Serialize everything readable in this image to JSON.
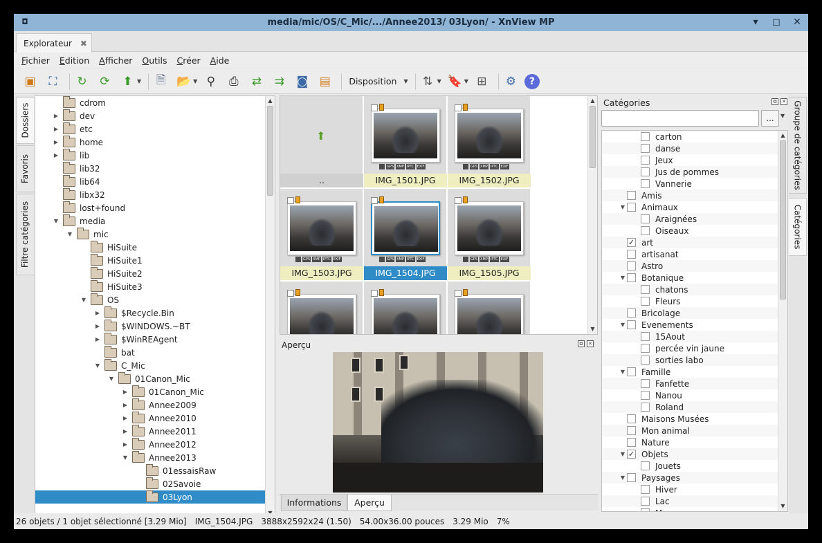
{
  "window": {
    "title": "media/mic/OS/C_Mic/.../Annee2013/ 03Lyon/ - XnView MP",
    "app_icon": "app-icon",
    "controls": [
      "minimize-icon",
      "maximize-icon",
      "close-icon"
    ]
  },
  "tab": {
    "label": "Explorateur"
  },
  "menu": [
    "Fichier",
    "Edition",
    "Afficher",
    "Outils",
    "Créer",
    "Aide"
  ],
  "toolbar": {
    "disposition_label": "Disposition"
  },
  "side_tabs": [
    "Dossiers",
    "Favoris",
    "Filtre catégories"
  ],
  "folder_tree": [
    {
      "label": "cdrom",
      "level": 1,
      "arrow": ""
    },
    {
      "label": "dev",
      "level": 1,
      "arrow": "▶"
    },
    {
      "label": "etc",
      "level": 1,
      "arrow": "▶"
    },
    {
      "label": "home",
      "level": 1,
      "arrow": "▶"
    },
    {
      "label": "lib",
      "level": 1,
      "arrow": "▶"
    },
    {
      "label": "lib32",
      "level": 1,
      "arrow": ""
    },
    {
      "label": "lib64",
      "level": 1,
      "arrow": ""
    },
    {
      "label": "libx32",
      "level": 1,
      "arrow": ""
    },
    {
      "label": "lost+found",
      "level": 1,
      "arrow": ""
    },
    {
      "label": "media",
      "level": 1,
      "arrow": "▼"
    },
    {
      "label": "mic",
      "level": 2,
      "arrow": "▼"
    },
    {
      "label": "HiSuite",
      "level": 3,
      "arrow": ""
    },
    {
      "label": "HiSuite1",
      "level": 3,
      "arrow": ""
    },
    {
      "label": "HiSuite2",
      "level": 3,
      "arrow": ""
    },
    {
      "label": "HiSuite3",
      "level": 3,
      "arrow": ""
    },
    {
      "label": "OS",
      "level": 3,
      "arrow": "▼"
    },
    {
      "label": "$Recycle.Bin",
      "level": 4,
      "arrow": "▶"
    },
    {
      "label": "$WINDOWS.~BT",
      "level": 4,
      "arrow": "▶"
    },
    {
      "label": "$WinREAgent",
      "level": 4,
      "arrow": "▶"
    },
    {
      "label": "bat",
      "level": 4,
      "arrow": ""
    },
    {
      "label": "C_Mic",
      "level": 4,
      "arrow": "▼"
    },
    {
      "label": "01Canon_Mic",
      "level": 5,
      "arrow": "▼"
    },
    {
      "label": "01Canon_Mic",
      "level": 6,
      "arrow": "▶"
    },
    {
      "label": "Annee2009",
      "level": 6,
      "arrow": "▶"
    },
    {
      "label": "Annee2010",
      "level": 6,
      "arrow": "▶"
    },
    {
      "label": "Annee2011",
      "level": 6,
      "arrow": "▶"
    },
    {
      "label": "Annee2012",
      "level": 6,
      "arrow": "▶"
    },
    {
      "label": "Annee2013",
      "level": 6,
      "arrow": "▼"
    },
    {
      "label": "01essaisRaw",
      "level": 7,
      "arrow": ""
    },
    {
      "label": "02Savoie",
      "level": 7,
      "arrow": ""
    },
    {
      "label": "03Lyon",
      "level": 7,
      "arrow": "",
      "selected": true
    }
  ],
  "thumbnails": [
    {
      "label": "..",
      "type": "parent"
    },
    {
      "label": "IMG_1501.JPG"
    },
    {
      "label": "IMG_1502.JPG"
    },
    {
      "label": "IMG_1503.JPG"
    },
    {
      "label": "IMG_1504.JPG",
      "selected": true
    },
    {
      "label": "IMG_1505.JPG"
    },
    {
      "label": ""
    },
    {
      "label": ""
    },
    {
      "label": ""
    }
  ],
  "meta_badges": [
    "GPS",
    "XMP",
    "IPTC",
    "EXIF"
  ],
  "preview": {
    "title": "Aperçu",
    "tabs": [
      "Informations",
      "Aperçu"
    ]
  },
  "categories": {
    "title": "Catégories",
    "more_label": "...",
    "items": [
      {
        "label": "carton",
        "level": 2,
        "checked": false,
        "arrow": ""
      },
      {
        "label": "danse",
        "level": 2,
        "checked": false,
        "arrow": ""
      },
      {
        "label": "Jeux",
        "level": 2,
        "checked": false,
        "arrow": ""
      },
      {
        "label": "Jus de pommes",
        "level": 2,
        "checked": false,
        "arrow": ""
      },
      {
        "label": "Vannerie",
        "level": 2,
        "checked": false,
        "arrow": ""
      },
      {
        "label": "Amis",
        "level": 1,
        "checked": false,
        "arrow": ""
      },
      {
        "label": "Animaux",
        "level": 1,
        "checked": false,
        "arrow": "▼"
      },
      {
        "label": "Araignées",
        "level": 2,
        "checked": false,
        "arrow": ""
      },
      {
        "label": "Oiseaux",
        "level": 2,
        "checked": false,
        "arrow": ""
      },
      {
        "label": "art",
        "level": 1,
        "checked": true,
        "arrow": ""
      },
      {
        "label": "artisanat",
        "level": 1,
        "checked": false,
        "arrow": ""
      },
      {
        "label": "Astro",
        "level": 1,
        "checked": false,
        "arrow": ""
      },
      {
        "label": "Botanique",
        "level": 1,
        "checked": false,
        "arrow": "▼"
      },
      {
        "label": " chatons",
        "level": 2,
        "checked": false,
        "arrow": ""
      },
      {
        "label": "Fleurs",
        "level": 2,
        "checked": false,
        "arrow": ""
      },
      {
        "label": "Bricolage",
        "level": 1,
        "checked": false,
        "arrow": ""
      },
      {
        "label": "Evenements",
        "level": 1,
        "checked": false,
        "arrow": "▼"
      },
      {
        "label": "15Aout",
        "level": 2,
        "checked": false,
        "arrow": ""
      },
      {
        "label": "percée vin jaune",
        "level": 2,
        "checked": false,
        "arrow": ""
      },
      {
        "label": "sorties labo",
        "level": 2,
        "checked": false,
        "arrow": ""
      },
      {
        "label": "Famille",
        "level": 1,
        "checked": false,
        "arrow": "▼"
      },
      {
        "label": "Fanfette",
        "level": 2,
        "checked": false,
        "arrow": ""
      },
      {
        "label": "Nanou",
        "level": 2,
        "checked": false,
        "arrow": ""
      },
      {
        "label": "Roland",
        "level": 2,
        "checked": false,
        "arrow": ""
      },
      {
        "label": "Maisons Musées",
        "level": 1,
        "checked": false,
        "arrow": ""
      },
      {
        "label": "Mon animal",
        "level": 1,
        "checked": false,
        "arrow": ""
      },
      {
        "label": "Nature",
        "level": 1,
        "checked": false,
        "arrow": ""
      },
      {
        "label": "Objets",
        "level": 1,
        "checked": true,
        "arrow": "▼"
      },
      {
        "label": "Jouets",
        "level": 2,
        "checked": false,
        "arrow": ""
      },
      {
        "label": "Paysages",
        "level": 1,
        "checked": false,
        "arrow": "▼"
      },
      {
        "label": "Hiver",
        "level": 2,
        "checked": false,
        "arrow": ""
      },
      {
        "label": "Lac",
        "level": 2,
        "checked": false,
        "arrow": ""
      },
      {
        "label": "M...",
        "level": 2,
        "checked": false,
        "arrow": ""
      }
    ]
  },
  "right_tabs": [
    "Groupe de catégories",
    "Catégories"
  ],
  "status": {
    "objects": "26 objets / 1 objet sélectionné [3.29 Mio]",
    "filename": "IMG_1504.JPG",
    "dimensions": "3888x2592x24 (1.50)",
    "print_size": "54.00x36.00 pouces",
    "filesize": "3.29 Mio",
    "zoom": "7%"
  },
  "colors": {
    "titlebar": "#8fb4d6",
    "selection": "#308cc6",
    "label_bg": "#eeeec0"
  }
}
